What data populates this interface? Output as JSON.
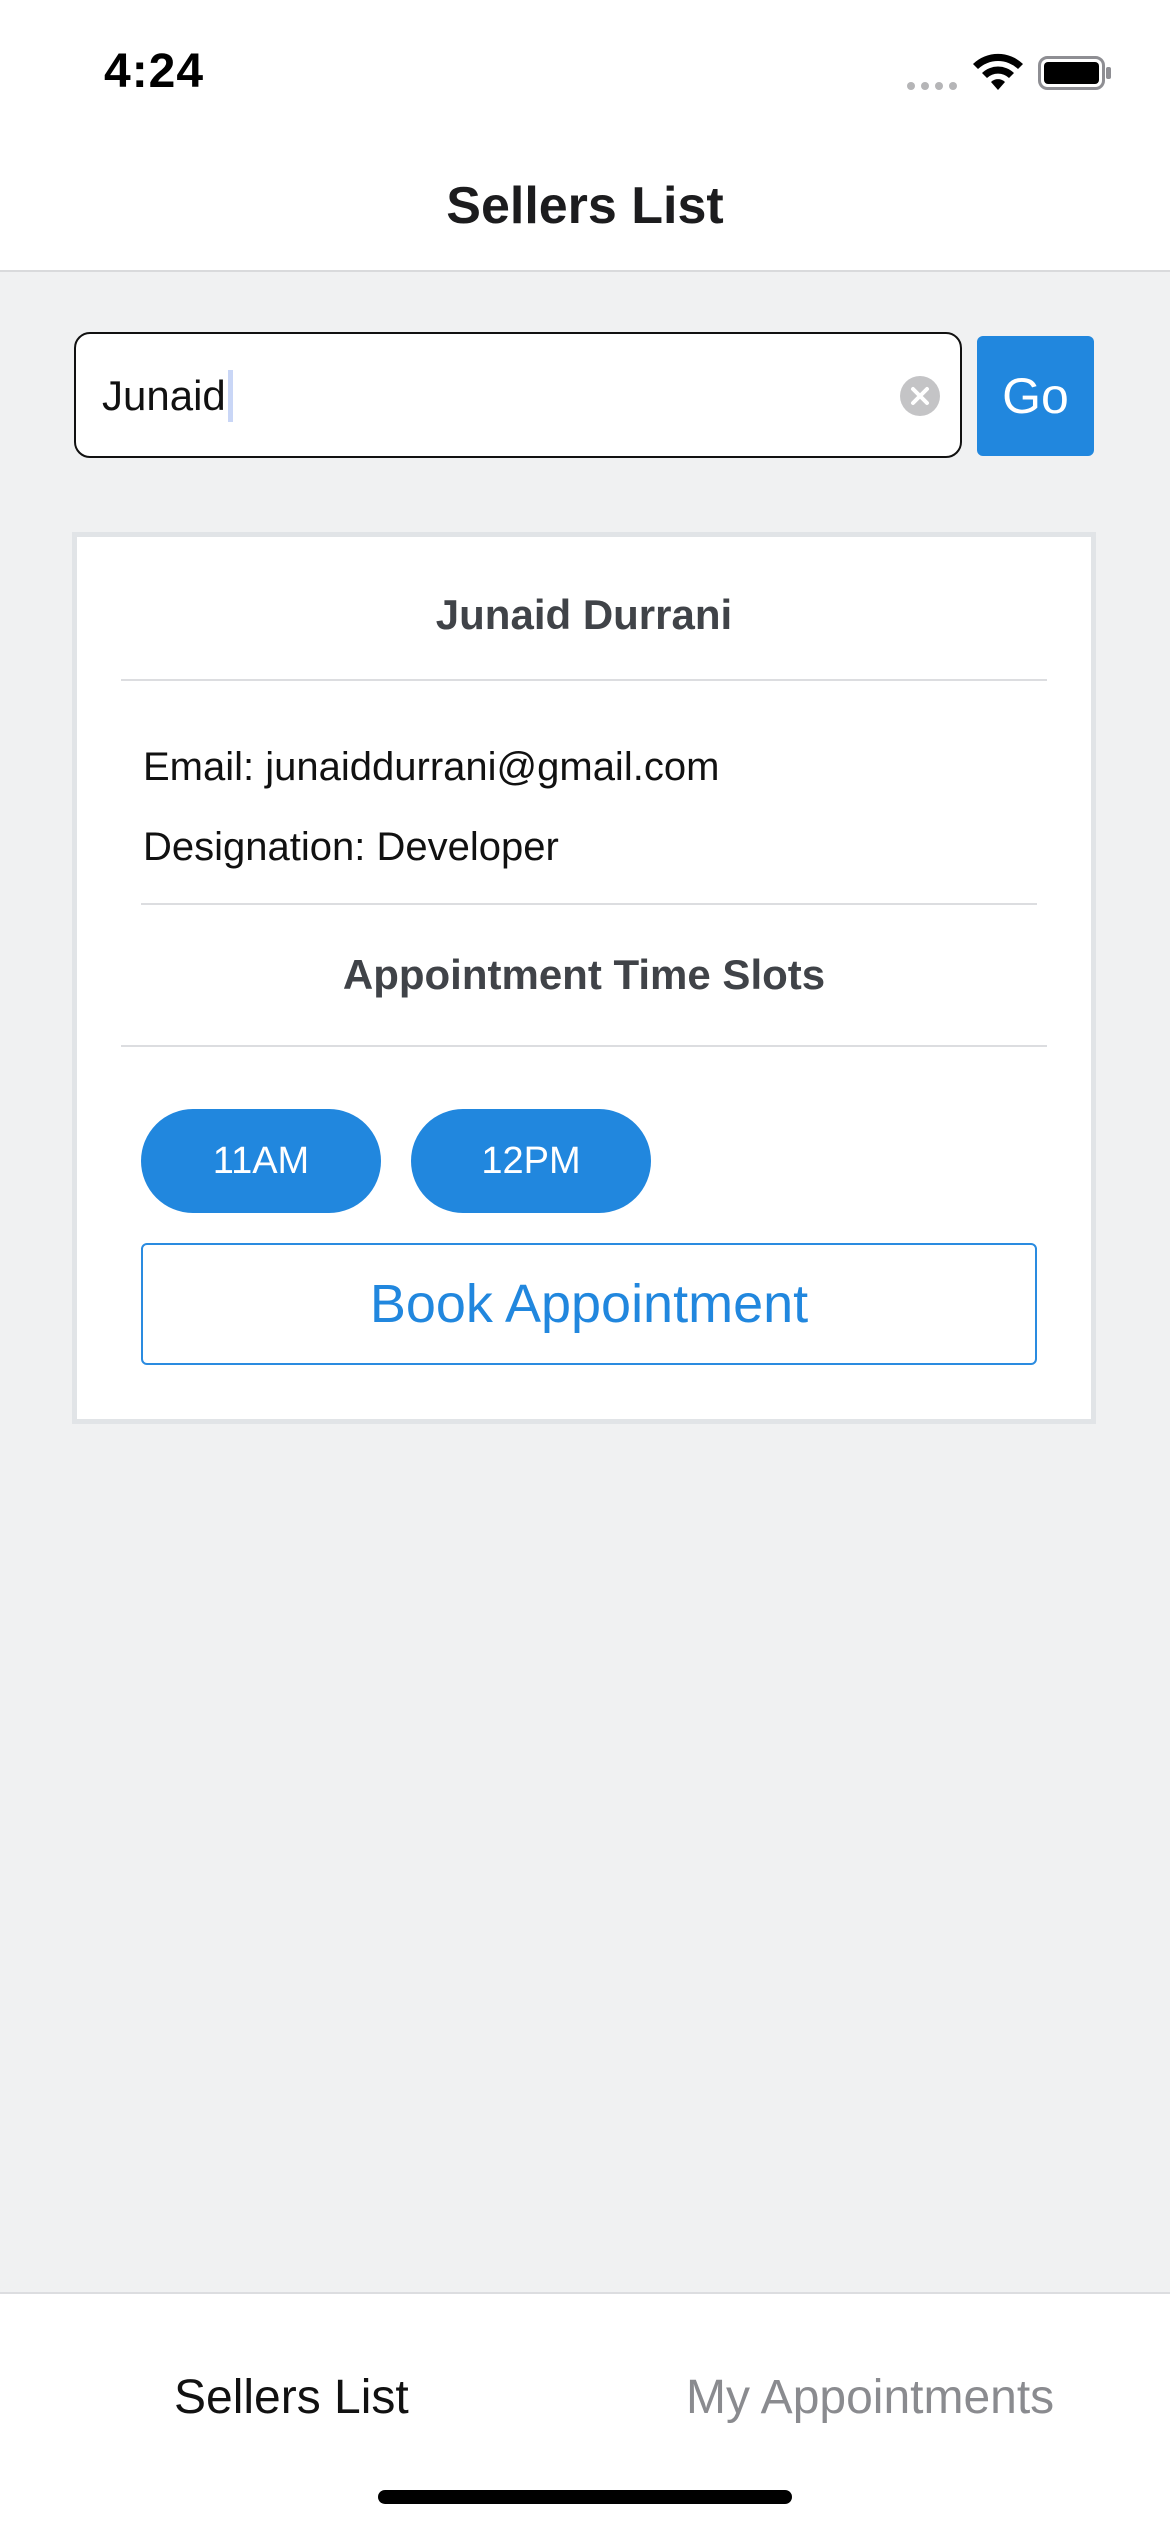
{
  "status_bar": {
    "time": "4:24",
    "icons": [
      "signal-icon",
      "wifi-icon",
      "battery-icon"
    ]
  },
  "header": {
    "title": "Sellers List"
  },
  "search": {
    "value": "Junaid",
    "go_label": "Go"
  },
  "seller": {
    "name": "Junaid Durrani",
    "email": "Email: junaiddurrani@gmail.com",
    "designation": "Designation: Developer",
    "slots_title": "Appointment Time Slots",
    "slots": [
      "11AM",
      "12PM"
    ],
    "book_label": "Book Appointment"
  },
  "tabs": [
    {
      "label": "Sellers List",
      "active": true
    },
    {
      "label": "My Appointments",
      "active": false
    }
  ],
  "colors": {
    "accent": "#2187de",
    "background": "#f0f1f2",
    "card_border": "#e1e4e7"
  }
}
